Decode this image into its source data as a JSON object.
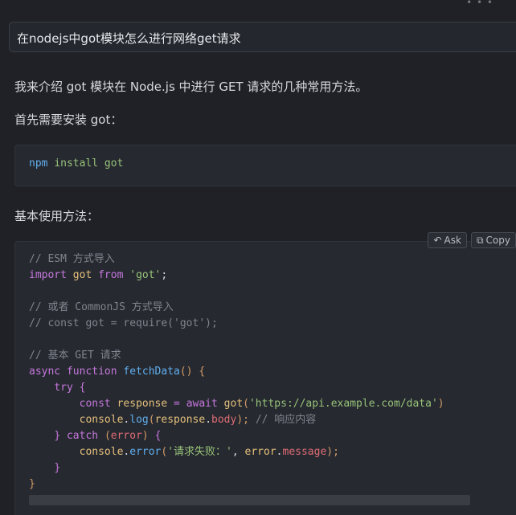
{
  "question": "在nodejs中got模块怎么进行网络get请求",
  "intro": "我来介绍 got 模块在 Node.js 中进行 GET 请求的几种常用方法。",
  "install_note": "首先需要安装 got：",
  "install_code": {
    "cmd": "npm",
    "args": "install got"
  },
  "basic_usage": "基本使用方法：",
  "toolbar": {
    "ask_label": "Ask",
    "copy_label": "Copy",
    "ask_icon": "undo-arrow-icon",
    "copy_icon": "copy-icon"
  },
  "code": {
    "c1": "// ESM 方式导入",
    "import_kw": "import",
    "got_name": "got",
    "from_kw": "from",
    "got_str": "'got'",
    "semi": ";",
    "c2": "// 或者 CommonJS 方式导入",
    "c3": "// const got = require('got');",
    "c4": "// 基本 GET 请求",
    "async_kw": "async",
    "function_kw": "function",
    "fn_name": "fetchData",
    "fn_parens": "()",
    "brace_open": "{",
    "try_kw": "try",
    "const_kw": "const",
    "response_var": "response",
    "eq": "=",
    "await_kw": "await",
    "got_call": "got",
    "paren_open": "(",
    "url_str": "'https://api.example.com/data'",
    "paren_close": ")",
    "console_obj": "console",
    "dot": ".",
    "log_fn": "log",
    "body_prop": "body",
    "close_semi": ");",
    "c5": "// 响应内容",
    "brace_close": "}",
    "catch_kw": "catch",
    "error_var": "error",
    "error_fn": "error",
    "err_str": "'请求失败：'",
    "comma": ",",
    "message_prop": "message"
  }
}
